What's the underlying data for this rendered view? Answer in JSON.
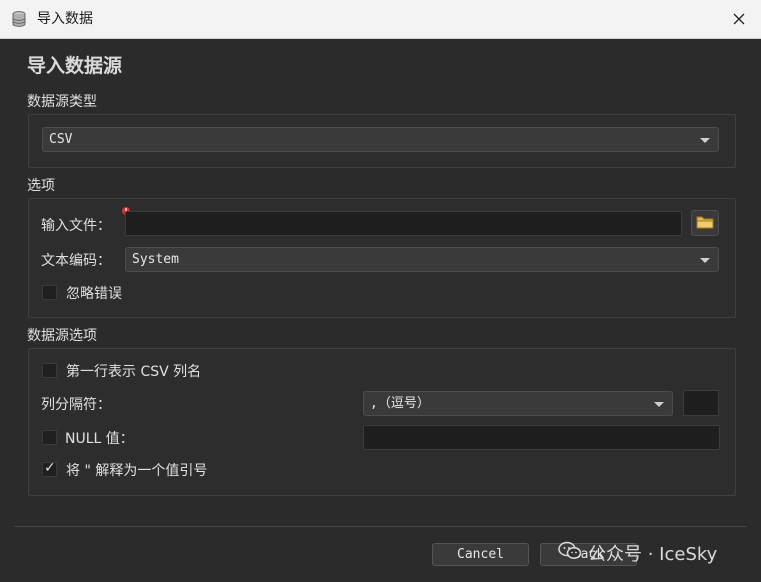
{
  "window": {
    "title": "导入数据"
  },
  "page": {
    "title": "导入数据源"
  },
  "source_type": {
    "section_label": "数据源类型",
    "selected": "CSV"
  },
  "options": {
    "section_label": "选项",
    "input_file_label": "输入文件：",
    "input_file_value": "",
    "encoding_label": "文本编码：",
    "encoding_value": "System",
    "ignore_errors_label": "忽略错误",
    "ignore_errors_checked": false
  },
  "source_options": {
    "section_label": "数据源选项",
    "first_row_header_label": "第一行表示 CSV 列名",
    "first_row_header_checked": false,
    "delimiter_label": "列分隔符：",
    "delimiter_value": ",（逗号）",
    "null_label": "NULL 值：",
    "null_checked": false,
    "null_value": "",
    "quote_label": "将 \" 解释为一个值引号",
    "quote_checked": true
  },
  "buttons": {
    "cancel": "Cancel",
    "back": "Back"
  },
  "watermark": "公众号 · IceSky",
  "icons": {
    "window": "database-icon",
    "close": "close-icon",
    "folder": "folder-icon",
    "required": "required-indicator-icon",
    "dropdown": "chevron-down-icon",
    "watermark": "wechat-icon"
  }
}
